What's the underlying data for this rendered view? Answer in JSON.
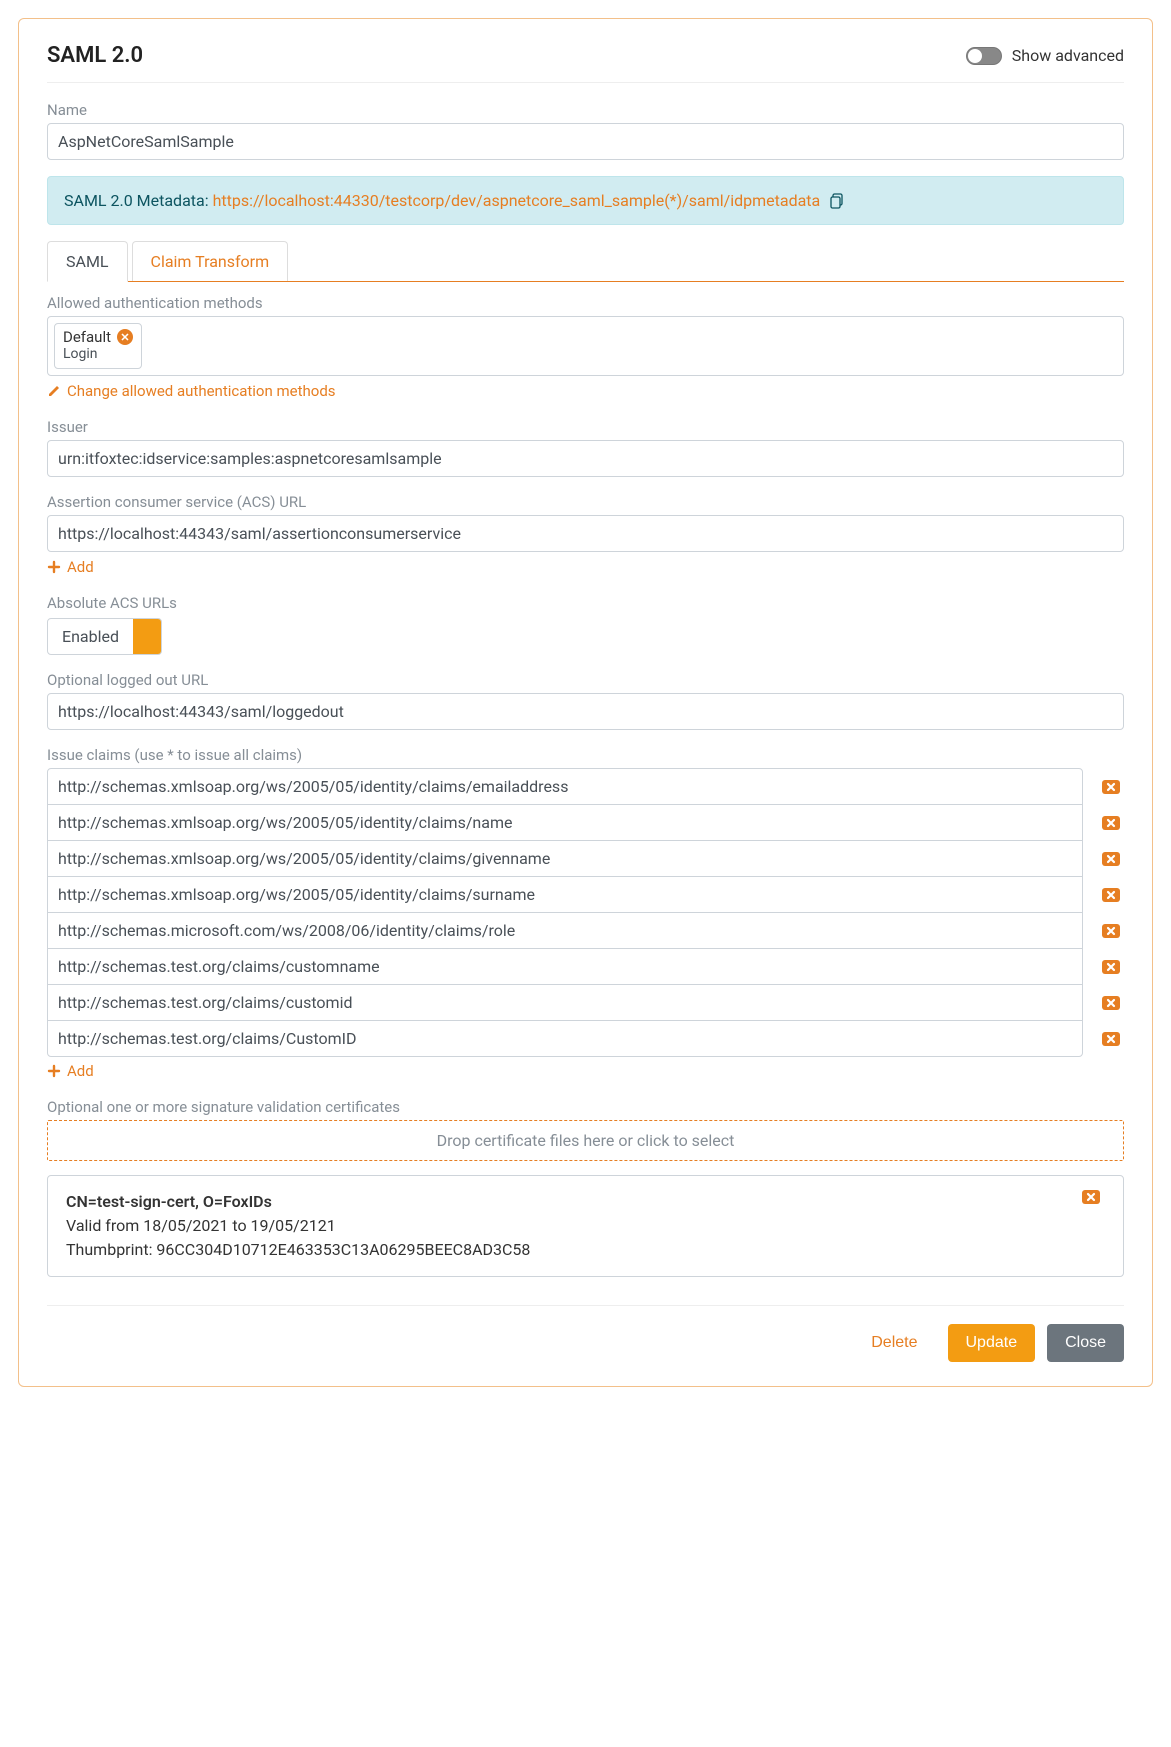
{
  "header": {
    "title": "SAML 2.0",
    "show_advanced_label": "Show advanced"
  },
  "name": {
    "label": "Name",
    "value": "AspNetCoreSamlSample"
  },
  "metadata": {
    "prefix": "SAML 2.0 Metadata:",
    "url": "https://localhost:44330/testcorp/dev/aspnetcore_saml_sample(*)/saml/idpmetadata"
  },
  "tabs": {
    "saml": "SAML",
    "claim_transform": "Claim Transform"
  },
  "auth_methods": {
    "label": "Allowed authentication methods",
    "tag_title": "Default",
    "tag_sub": "Login",
    "change_label": "Change allowed authentication methods"
  },
  "issuer": {
    "label": "Issuer",
    "value": "urn:itfoxtec:idservice:samples:aspnetcoresamlsample"
  },
  "acs": {
    "label": "Assertion consumer service (ACS) URL",
    "value": "https://localhost:44343/saml/assertionconsumerservice",
    "add_label": "Add"
  },
  "abs_acs": {
    "label": "Absolute ACS URLs",
    "state": "Enabled"
  },
  "logged_out": {
    "label": "Optional logged out URL",
    "value": "https://localhost:44343/saml/loggedout"
  },
  "claims": {
    "label": "Issue claims (use * to issue all claims)",
    "rows": [
      "http://schemas.xmlsoap.org/ws/2005/05/identity/claims/emailaddress",
      "http://schemas.xmlsoap.org/ws/2005/05/identity/claims/name",
      "http://schemas.xmlsoap.org/ws/2005/05/identity/claims/givenname",
      "http://schemas.xmlsoap.org/ws/2005/05/identity/claims/surname",
      "http://schemas.microsoft.com/ws/2008/06/identity/claims/role",
      "http://schemas.test.org/claims/customname",
      "http://schemas.test.org/claims/customid",
      "http://schemas.test.org/claims/CustomID"
    ],
    "add_label": "Add"
  },
  "certs": {
    "label": "Optional one or more signature validation certificates",
    "dropzone": "Drop certificate files here or click to select",
    "item": {
      "title": "CN=test-sign-cert, O=FoxIDs",
      "valid": "Valid from 18/05/2021 to 19/05/2121",
      "thumb": "Thumbprint: 96CC304D10712E463353C13A06295BEEC8AD3C58"
    }
  },
  "footer": {
    "delete": "Delete",
    "update": "Update",
    "close": "Close"
  }
}
